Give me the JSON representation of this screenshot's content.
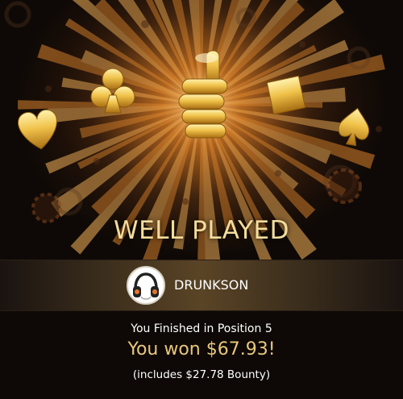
{
  "banner": {
    "title": "WELL PLAYED"
  },
  "player": {
    "name": "DRUNKSON",
    "avatar_icon": "headphones-icon"
  },
  "result": {
    "position_text": "You Finished in Position 5",
    "won_text": "You won $67.93!",
    "bounty_text": "(includes $27.78 Bounty)"
  },
  "colors": {
    "gold": "#e9c77a",
    "title": "#f3dd9d",
    "glow": "#c8741f"
  }
}
